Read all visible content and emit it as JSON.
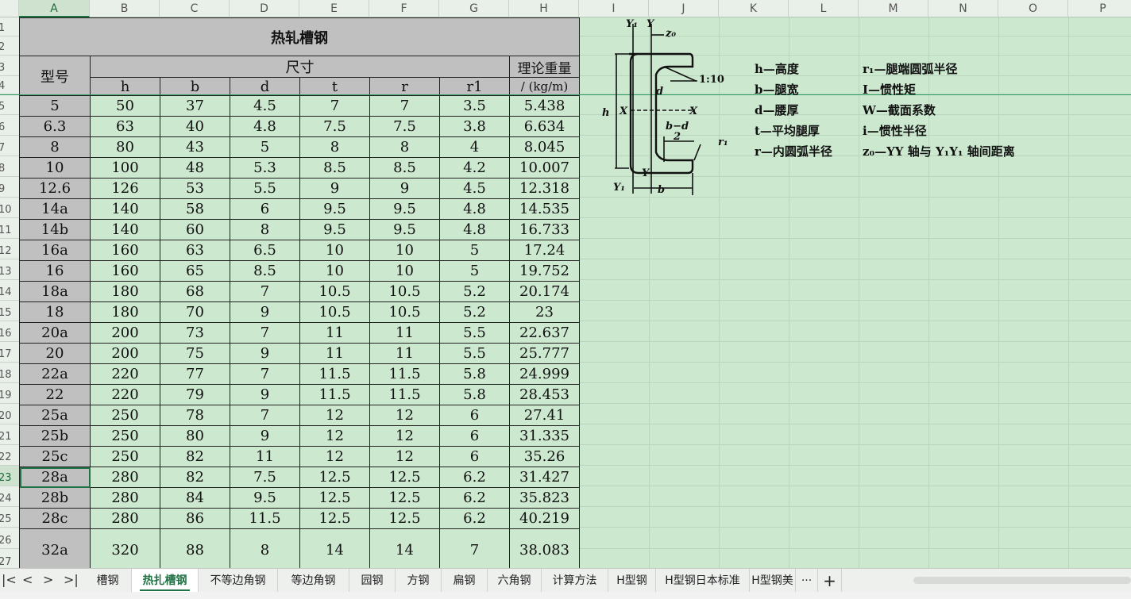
{
  "columns": [
    "A",
    "B",
    "C",
    "D",
    "E",
    "F",
    "G",
    "H",
    "I",
    "J",
    "K",
    "L",
    "M",
    "N",
    "O",
    "P"
  ],
  "rows": [
    "1",
    "2",
    "3",
    "4",
    "5",
    "6",
    "7",
    "8",
    "9",
    "10",
    "11",
    "12",
    "13",
    "14",
    "15",
    "16",
    "17",
    "18",
    "19",
    "20",
    "21",
    "22",
    "23",
    "24",
    "25",
    "26",
    "27"
  ],
  "selected_cell": "A23",
  "table": {
    "title": "热轧槽钢",
    "model_label": "型号",
    "dims_label": "尺寸",
    "weight_label_1": "理论重量",
    "weight_label_2": "/ (kg/m)",
    "sub_headers": [
      "h",
      "b",
      "d",
      "t",
      "r",
      "r1"
    ],
    "data": [
      [
        "5",
        "50",
        "37",
        "4.5",
        "7",
        "7",
        "3.5",
        "5.438"
      ],
      [
        "6.3",
        "63",
        "40",
        "4.8",
        "7.5",
        "7.5",
        "3.8",
        "6.634"
      ],
      [
        "8",
        "80",
        "43",
        "5",
        "8",
        "8",
        "4",
        "8.045"
      ],
      [
        "10",
        "100",
        "48",
        "5.3",
        "8.5",
        "8.5",
        "4.2",
        "10.007"
      ],
      [
        "12.6",
        "126",
        "53",
        "5.5",
        "9",
        "9",
        "4.5",
        "12.318"
      ],
      [
        "14a",
        "140",
        "58",
        "6",
        "9.5",
        "9.5",
        "4.8",
        "14.535"
      ],
      [
        "14b",
        "140",
        "60",
        "8",
        "9.5",
        "9.5",
        "4.8",
        "16.733"
      ],
      [
        "16a",
        "160",
        "63",
        "6.5",
        "10",
        "10",
        "5",
        "17.24"
      ],
      [
        "16",
        "160",
        "65",
        "8.5",
        "10",
        "10",
        "5",
        "19.752"
      ],
      [
        "18a",
        "180",
        "68",
        "7",
        "10.5",
        "10.5",
        "5.2",
        "20.174"
      ],
      [
        "18",
        "180",
        "70",
        "9",
        "10.5",
        "10.5",
        "5.2",
        "23"
      ],
      [
        "20a",
        "200",
        "73",
        "7",
        "11",
        "11",
        "5.5",
        "22.637"
      ],
      [
        "20",
        "200",
        "75",
        "9",
        "11",
        "11",
        "5.5",
        "25.777"
      ],
      [
        "22a",
        "220",
        "77",
        "7",
        "11.5",
        "11.5",
        "5.8",
        "24.999"
      ],
      [
        "22",
        "220",
        "79",
        "9",
        "11.5",
        "11.5",
        "5.8",
        "28.453"
      ],
      [
        "25a",
        "250",
        "78",
        "7",
        "12",
        "12",
        "6",
        "27.41"
      ],
      [
        "25b",
        "250",
        "80",
        "9",
        "12",
        "12",
        "6",
        "31.335"
      ],
      [
        "25c",
        "250",
        "82",
        "11",
        "12",
        "12",
        "6",
        "35.26"
      ],
      [
        "28a",
        "280",
        "82",
        "7.5",
        "12.5",
        "12.5",
        "6.2",
        "31.427"
      ],
      [
        "28b",
        "280",
        "84",
        "9.5",
        "12.5",
        "12.5",
        "6.2",
        "35.823"
      ],
      [
        "28c",
        "280",
        "86",
        "11.5",
        "12.5",
        "12.5",
        "6.2",
        "40.219"
      ],
      [
        "32a",
        "320",
        "88",
        "8",
        "14",
        "14",
        "7",
        "38.083"
      ]
    ]
  },
  "diagram": {
    "labels": {
      "y1_top": "Y₁",
      "y_top": "Y",
      "z0": "z₀",
      "slope": "1:10",
      "h": "h",
      "d": "d",
      "x_left": "X",
      "x_right": "X",
      "bd2_num": "b−d",
      "bd2_den": "2",
      "r1": "r₁",
      "y_bottom": "Y",
      "y1_bottom": "Y₁",
      "b": "b"
    }
  },
  "legend": {
    "left": [
      "h—高度",
      "b—腿宽",
      "d—腰厚",
      "t—平均腿厚",
      "r—内圆弧半径"
    ],
    "right": [
      "r₁—腿端圆弧半径",
      "I—惯性矩",
      "W—截面系数",
      "i—惯性半径",
      "z₀—YY 轴与 Y₁Y₁ 轴间距离"
    ]
  },
  "tabs": {
    "items": [
      "槽钢",
      "热扎槽钢",
      "不等边角钢",
      "等边角钢",
      "园钢",
      "方钢",
      "扁钢",
      "六角钢",
      "计算方法",
      "H型钢",
      "H型钢日本标准",
      "H型钢美"
    ],
    "active": "热扎槽钢",
    "more": "···",
    "add": "+",
    "nav": [
      "|<",
      "<",
      ">",
      ">|"
    ]
  }
}
